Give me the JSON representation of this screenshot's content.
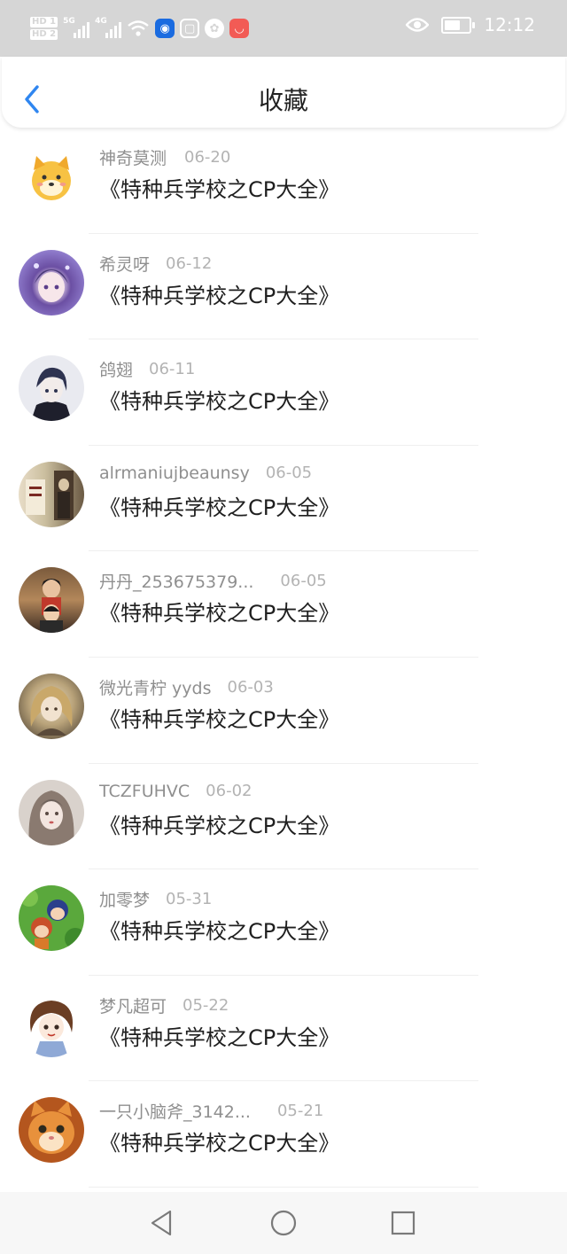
{
  "status_bar": {
    "sim1": "HD 1",
    "sim2": "HD 2",
    "net1": "5G",
    "net2": "4G",
    "time": "12:12",
    "icons": [
      "signal-icon",
      "signal-icon",
      "wifi-icon",
      "app-notification-icon",
      "app-notification-icon",
      "app-notification-icon",
      "app-notification-icon",
      "eye-icon",
      "battery-icon"
    ]
  },
  "header": {
    "title": "收藏"
  },
  "favorites": [
    {
      "user": "神奇莫测",
      "date": "06-20",
      "title": "《特种兵学校之CP大全》"
    },
    {
      "user": "希灵呀",
      "date": "06-12",
      "title": "《特种兵学校之CP大全》"
    },
    {
      "user": "鸽翅",
      "date": "06-11",
      "title": "《特种兵学校之CP大全》"
    },
    {
      "user": "alrmaniujbeaunsy",
      "date": "06-05",
      "title": "《特种兵学校之CP大全》"
    },
    {
      "user": "丹丹_253675379...",
      "date": "06-05",
      "title": "《特种兵学校之CP大全》"
    },
    {
      "user": "微光青柠 yyds",
      "date": "06-03",
      "title": "《特种兵学校之CP大全》"
    },
    {
      "user": "TCZFUHVC",
      "date": "06-02",
      "title": "《特种兵学校之CP大全》"
    },
    {
      "user": "加零梦",
      "date": "05-31",
      "title": "《特种兵学校之CP大全》"
    },
    {
      "user": "梦凡超可",
      "date": "05-22",
      "title": "《特种兵学校之CP大全》"
    },
    {
      "user": "一只小脑斧_3142...",
      "date": "05-21",
      "title": "《特种兵学校之CP大全》"
    }
  ],
  "colors": {
    "accent": "#2f86f0",
    "status_bar": "#d6d6d6",
    "username": "#8f8f8f",
    "date": "#b3b3b3",
    "title": "#1f1f1f"
  },
  "nav": [
    "back-triangle-icon",
    "home-circle-icon",
    "recents-square-icon"
  ]
}
